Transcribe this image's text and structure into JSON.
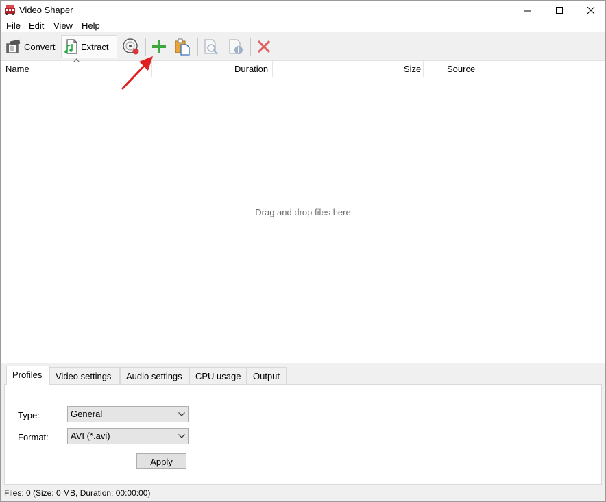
{
  "window": {
    "title": "Video Shaper"
  },
  "menu": [
    "File",
    "Edit",
    "View",
    "Help"
  ],
  "toolbar": {
    "convert_label": "Convert",
    "extract_label": "Extract"
  },
  "columns": {
    "name": "Name",
    "duration": "Duration",
    "size": "Size",
    "source": "Source"
  },
  "list": {
    "empty_hint": "Drag and drop files here"
  },
  "tabs": [
    "Profiles",
    "Video settings",
    "Audio settings",
    "CPU usage",
    "Output"
  ],
  "active_tab": "Profiles",
  "profiles": {
    "type_label": "Type:",
    "type_value": "General",
    "format_label": "Format:",
    "format_value": "AVI (*.avi)",
    "apply_label": "Apply"
  },
  "status": {
    "text": "Files: 0 (Size: 0 MB, Duration: 00:00:00)"
  },
  "colors": {
    "add": "#3aa83a",
    "remove": "#e06060",
    "arrow": "#e02020"
  },
  "icons": [
    "film-icon",
    "music-file-icon",
    "disc-record-icon",
    "add-icon",
    "paste-icon",
    "preview-icon",
    "file-info-icon",
    "remove-icon"
  ]
}
